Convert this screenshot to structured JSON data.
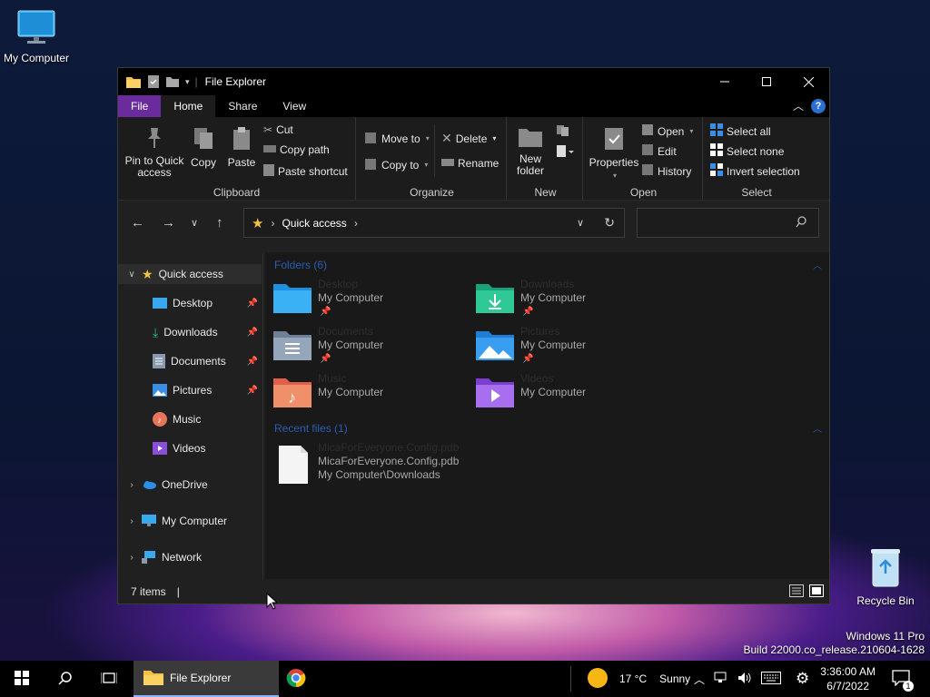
{
  "desktop": {
    "my_computer": "My Computer",
    "recycle_bin": "Recycle Bin",
    "watermark_line1": "Windows 11 Pro",
    "watermark_line2": "Build 22000.co_release.210604-1628"
  },
  "window": {
    "title": "File Explorer",
    "tabs": {
      "file": "File",
      "home": "Home",
      "share": "Share",
      "view": "View"
    },
    "help": "?",
    "ribbon": {
      "clipboard": {
        "label": "Clipboard",
        "pin_line1": "Pin to Quick",
        "pin_line2": "access",
        "copy": "Copy",
        "paste": "Paste",
        "cut": "Cut",
        "copy_path": "Copy path",
        "paste_shortcut": "Paste shortcut"
      },
      "organize": {
        "label": "Organize",
        "move_to": "Move to",
        "copy_to": "Copy to",
        "delete": "Delete",
        "rename": "Rename"
      },
      "new": {
        "label": "New",
        "new_folder_line1": "New",
        "new_folder_line2": "folder"
      },
      "open": {
        "label": "Open",
        "properties": "Properties",
        "open": "Open",
        "edit": "Edit",
        "history": "History"
      },
      "select": {
        "label": "Select",
        "select_all": "Select all",
        "select_none": "Select none",
        "invert": "Invert selection"
      }
    },
    "address": {
      "crumb": "Quick access",
      "sep1": "›",
      "sep2": "›"
    },
    "nav": {
      "quick_access": "Quick access",
      "desktop": "Desktop",
      "downloads": "Downloads",
      "documents": "Documents",
      "pictures": "Pictures",
      "music": "Music",
      "videos": "Videos",
      "onedrive": "OneDrive",
      "my_computer": "My Computer",
      "network": "Network"
    },
    "content": {
      "folders_header": "Folders (6)",
      "recent_header": "Recent files (1)",
      "folders": [
        {
          "name": "Desktop",
          "location": "My Computer",
          "pinned": "📌"
        },
        {
          "name": "Downloads",
          "location": "My Computer",
          "pinned": "📌"
        },
        {
          "name": "Documents",
          "location": "My Computer",
          "pinned": "📌"
        },
        {
          "name": "Pictures",
          "location": "My Computer",
          "pinned": "📌"
        },
        {
          "name": "Music",
          "location": "My Computer"
        },
        {
          "name": "Videos",
          "location": "My Computer"
        }
      ],
      "recent": {
        "name_dim": "MicaForEveryone.Config.pdb",
        "name": "MicaForEveryone.Config.pdb",
        "path": "My Computer\\Downloads"
      }
    },
    "status": {
      "items": "7 items",
      "sep": "|"
    }
  },
  "taskbar": {
    "explorer_label": "File Explorer",
    "weather": "17 °C",
    "weather_desc": "Sunny",
    "time": "3:36:00 AM",
    "date": "6/7/2022",
    "notif_count": "1"
  },
  "colors": {
    "accent": "#6a2c9c",
    "header_blue": "#2a5db3"
  }
}
